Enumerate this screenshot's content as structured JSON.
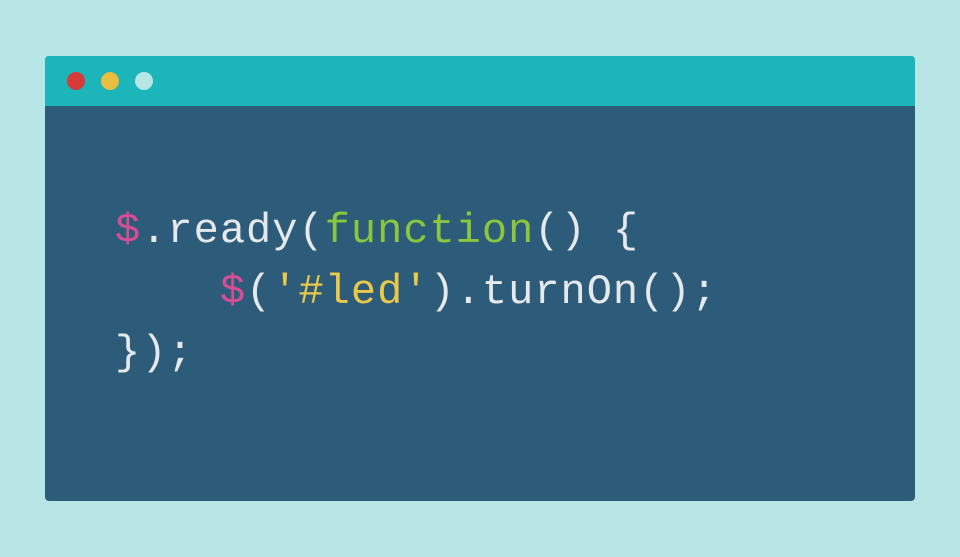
{
  "window": {
    "controls": {
      "close": "close",
      "minimize": "minimize",
      "maximize": "maximize"
    }
  },
  "colors": {
    "background": "#b8e5e5",
    "titlebar": "#1cb5ba",
    "body": "#2d5c7a",
    "close": "#d83a3a",
    "min": "#e9bd3e",
    "max": "#b8e5e5",
    "text_default": "#e6e9ec",
    "text_dollar": "#d64d93",
    "text_keyword": "#8bc63f",
    "text_string": "#e9c84a"
  },
  "code": {
    "line1": {
      "t1": "$",
      "t2": ".ready(",
      "t3": "function",
      "t4": "() {"
    },
    "line2": {
      "indent": "    ",
      "t1": "$",
      "t2": "(",
      "t3": "'#led'",
      "t4": ").turnOn();"
    },
    "line3": {
      "t1": "});"
    }
  }
}
